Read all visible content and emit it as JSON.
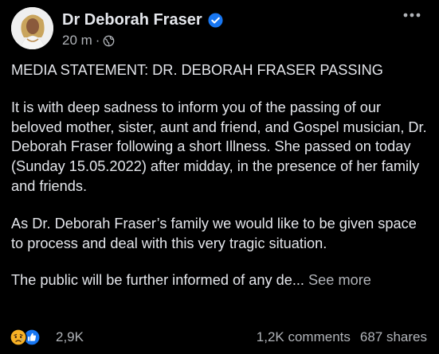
{
  "post": {
    "author": "Dr Deborah Fraser",
    "verified": true,
    "time": "20 m",
    "separator": "·",
    "privacy_icon": "globe-icon",
    "more_icon": "more-horizontal-icon",
    "paragraphs": [
      "MEDIA STATEMENT: DR. DEBORAH FRASER PASSING",
      "It is with deep sadness to inform you of the passing of our  beloved mother, sister, aunt and friend, and Gospel musician, Dr. Deborah Fraser following a short Illness. She passed on today (Sunday 15.05.2022) after midday, in the presence of her family and friends.",
      "As Dr. Deborah Fraser’s family we would like to be given space to process and deal with this very tragic situation."
    ],
    "truncated_text": "The public will be further informed of any de...",
    "see_more": "See more"
  },
  "footer": {
    "reaction_icons": [
      "sad-reaction-icon",
      "like-reaction-icon"
    ],
    "reaction_count": "2,9K",
    "comments": "1,2K comments",
    "shares": "687 shares"
  },
  "colors": {
    "background": "#000000",
    "text_primary": "#e4e6eb",
    "text_secondary": "#b0b3b8",
    "verified_blue": "#1877f2",
    "like_blue": "#1877f2",
    "sad_yellow": "#f7b125"
  }
}
